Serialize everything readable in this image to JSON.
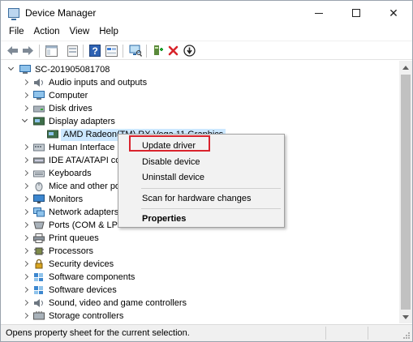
{
  "window": {
    "title": "Device Manager",
    "controls": {
      "minimize": "",
      "maximize": "",
      "close": "✕"
    }
  },
  "menu": [
    "File",
    "Action",
    "View",
    "Help"
  ],
  "toolbar": {
    "buttons": [
      "back-icon",
      "forward-icon",
      "tree-view-icon",
      "properties-icon",
      "help-icon",
      "show-hidden-icon",
      "scan-hardware-icon",
      "add-driver-icon",
      "uninstall-icon",
      "update-driver-icon"
    ]
  },
  "tree": {
    "root": "SC-201905081708",
    "items": [
      {
        "label": "Audio inputs and outputs",
        "icon": "audio-icon",
        "expanded": false
      },
      {
        "label": "Computer",
        "icon": "computer-icon",
        "expanded": false
      },
      {
        "label": "Disk drives",
        "icon": "disk-icon",
        "expanded": false
      },
      {
        "label": "Display adapters",
        "icon": "display-icon",
        "expanded": true
      },
      {
        "label": "AMD Radeon(TM) RX Vega 11 Graphics",
        "icon": "display-icon",
        "child": true,
        "selected": true
      },
      {
        "label": "Human Interface D",
        "icon": "hid-icon",
        "expanded": false
      },
      {
        "label": "IDE ATA/ATAPI co",
        "icon": "ide-icon",
        "expanded": false
      },
      {
        "label": "Keyboards",
        "icon": "keyboard-icon",
        "expanded": false
      },
      {
        "label": "Mice and other po",
        "icon": "mouse-icon",
        "expanded": false
      },
      {
        "label": "Monitors",
        "icon": "monitor-icon",
        "expanded": false
      },
      {
        "label": "Network adapters",
        "icon": "network-icon",
        "expanded": false
      },
      {
        "label": "Ports (COM & LPT",
        "icon": "ports-icon",
        "expanded": false
      },
      {
        "label": "Print queues",
        "icon": "printer-icon",
        "expanded": false
      },
      {
        "label": "Processors",
        "icon": "processor-icon",
        "expanded": false
      },
      {
        "label": "Security devices",
        "icon": "security-icon",
        "expanded": false
      },
      {
        "label": "Software components",
        "icon": "software-icon",
        "expanded": false
      },
      {
        "label": "Software devices",
        "icon": "software-icon",
        "expanded": false
      },
      {
        "label": "Sound, video and game controllers",
        "icon": "sound-icon",
        "expanded": false
      },
      {
        "label": "Storage controllers",
        "icon": "storage-icon",
        "expanded": false
      }
    ]
  },
  "context_menu": {
    "items": [
      "Update driver",
      "Disable device",
      "Uninstall device",
      "Scan for hardware changes",
      "Properties"
    ],
    "highlighted": "Update driver"
  },
  "status": {
    "text": "Opens property sheet for the current selection."
  },
  "colors": {
    "selection": "#cce8ff",
    "highlight_border": "#d9232d",
    "menu_bg": "#f2f2f2"
  }
}
